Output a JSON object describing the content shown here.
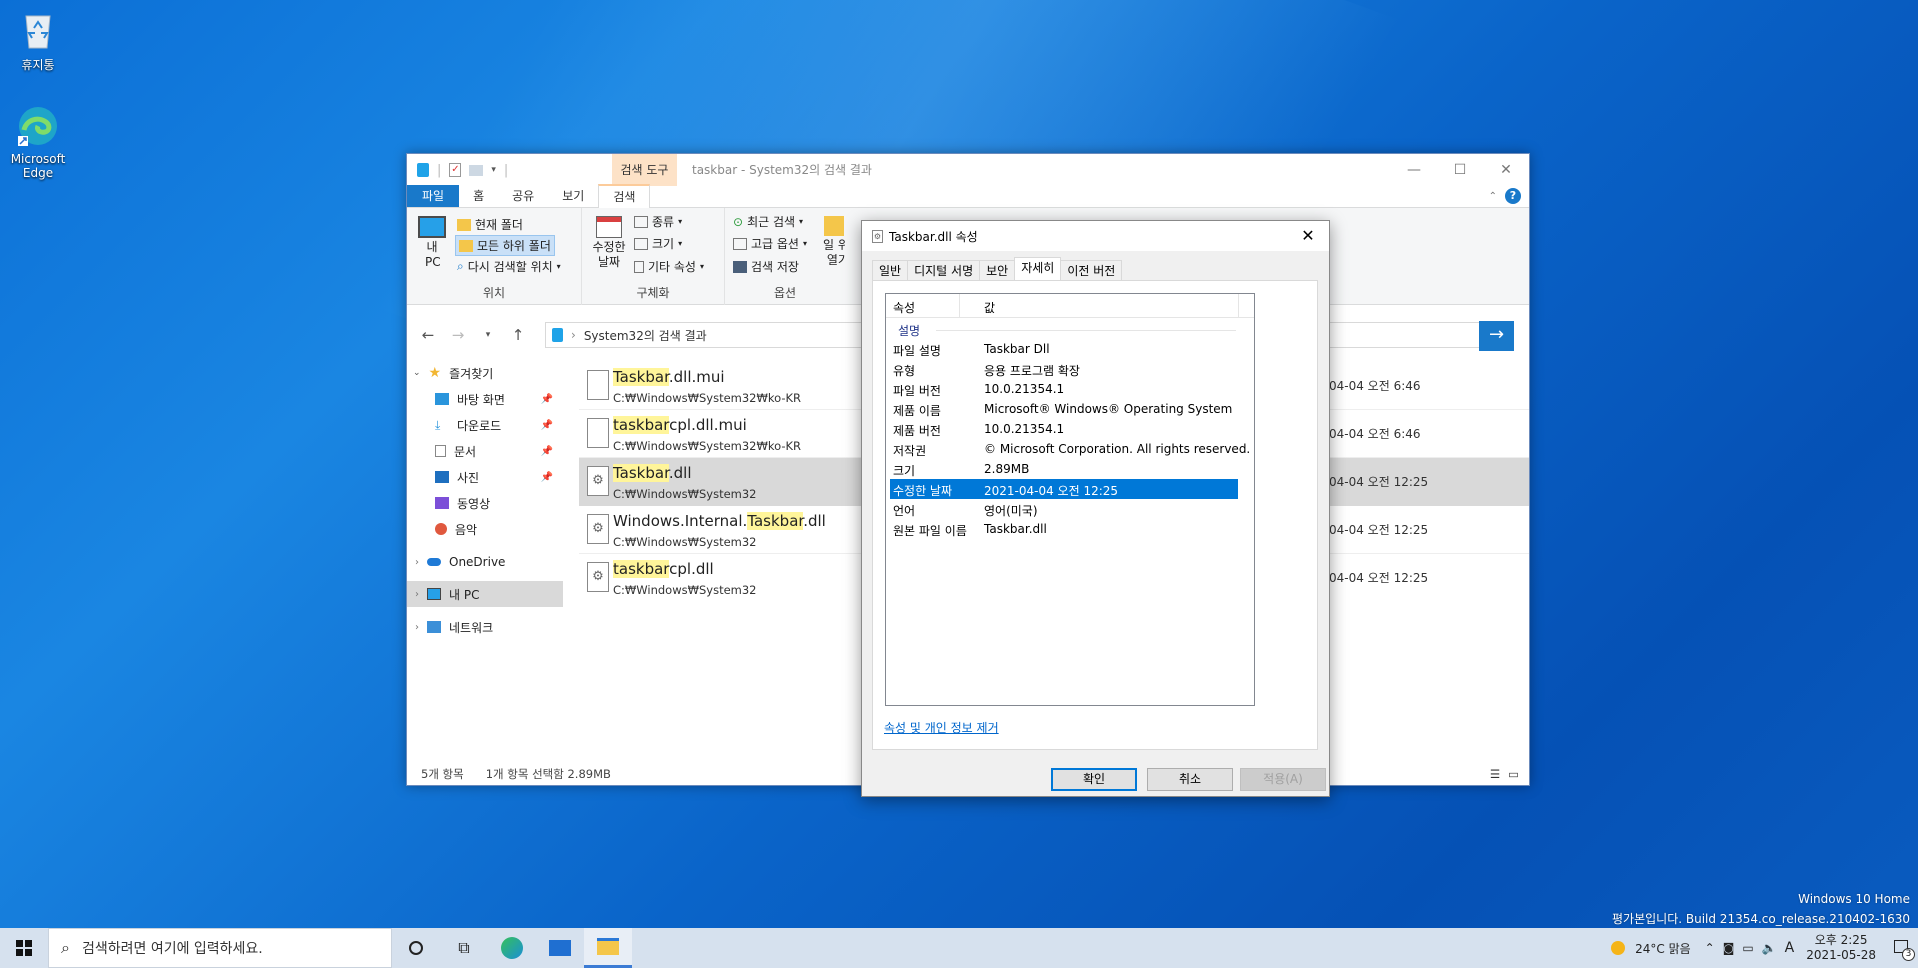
{
  "desktop": {
    "icons": [
      {
        "label": "휴지통",
        "icon": "recycle-bin-icon"
      },
      {
        "label": "Microsoft Edge",
        "icon": "edge-icon"
      }
    ],
    "watermark": {
      "line1": "Windows 10 Home",
      "line2": "평가본입니다. Build 21354.co_release.210402-1630"
    }
  },
  "explorer": {
    "context_tab": "검색 도구",
    "title": "taskbar - System32의 검색 결과",
    "tabs": [
      "파일",
      "홈",
      "공유",
      "보기",
      "검색"
    ],
    "ribbon": {
      "location": {
        "this_pc": "내 PC",
        "current_folder": "현재 폴더",
        "all_subfolders": "모든 하위 폴더",
        "search_again": "다시 검색할 위치",
        "label": "위치"
      },
      "refine": {
        "date_modified": "수정한 날짜",
        "kind": "종류",
        "size": "크기",
        "other_props": "기타 속성",
        "label": "구체화"
      },
      "options": {
        "recent": "최근 검색",
        "advanced": "고급 옵션",
        "save": "검색 저장",
        "open_location": "파일 위치 열기",
        "label": "옵션"
      }
    },
    "address": "System32의 검색 결과",
    "nav": {
      "quick_access": "즐겨찾기",
      "items": [
        "바탕 화면",
        "다운로드",
        "문서",
        "사진",
        "동영상",
        "음악"
      ],
      "onedrive": "OneDrive",
      "this_pc": "내 PC",
      "network": "네트워크"
    },
    "files": [
      {
        "pre": "",
        "hl": "Taskbar",
        "post": ".dll.mui",
        "path": "C:₩Windows₩System32₩ko-KR",
        "date": "04-04 오전 6:46"
      },
      {
        "pre": "",
        "hl": "taskbar",
        "post": "cpl.dll.mui",
        "path": "C:₩Windows₩System32₩ko-KR",
        "date": "04-04 오전 6:46"
      },
      {
        "pre": "",
        "hl": "Taskbar",
        "post": ".dll",
        "path": "C:₩Windows₩System32",
        "date": "04-04 오전 12:25"
      },
      {
        "pre": "Windows.Internal.",
        "hl": "Taskbar",
        "post": ".dll",
        "path": "C:₩Windows₩System32",
        "date": "04-04 오전 12:25"
      },
      {
        "pre": "",
        "hl": "taskbar",
        "post": "cpl.dll",
        "path": "C:₩Windows₩System32",
        "date": "04-04 오전 12:25"
      }
    ],
    "status": {
      "count": "5개 항목",
      "selected": "1개 항목 선택함 2.89MB"
    }
  },
  "props": {
    "title": "Taskbar.dll 속성",
    "tabs": [
      "일반",
      "디지털 서명",
      "보안",
      "자세히",
      "이전 버전"
    ],
    "col_prop": "속성",
    "col_value": "값",
    "group": "설명",
    "rows": [
      {
        "k": "파일 설명",
        "v": "Taskbar Dll"
      },
      {
        "k": "유형",
        "v": "응용 프로그램 확장"
      },
      {
        "k": "파일 버전",
        "v": "10.0.21354.1"
      },
      {
        "k": "제품 이름",
        "v": "Microsoft® Windows® Operating System"
      },
      {
        "k": "제품 버전",
        "v": "10.0.21354.1"
      },
      {
        "k": "저작권",
        "v": "© Microsoft Corporation. All rights reserved."
      },
      {
        "k": "크기",
        "v": "2.89MB"
      },
      {
        "k": "수정한 날짜",
        "v": "2021-04-04 오전 12:25"
      },
      {
        "k": "언어",
        "v": "영어(미국)"
      },
      {
        "k": "원본 파일 이름",
        "v": "Taskbar.dll"
      }
    ],
    "remove_link": "속성 및 개인 정보 제거",
    "ok": "확인",
    "cancel": "취소",
    "apply": "적용(A)"
  },
  "taskbar": {
    "search_placeholder": "검색하려면 여기에 입력하세요.",
    "weather": "24°C 맑음",
    "ime": "A",
    "time": "오후 2:25",
    "date": "2021-05-28",
    "notification_count": "3"
  },
  "colors": {
    "accent": "#1979ca",
    "selection": "#0078d7",
    "highlight": "#fff59a"
  }
}
